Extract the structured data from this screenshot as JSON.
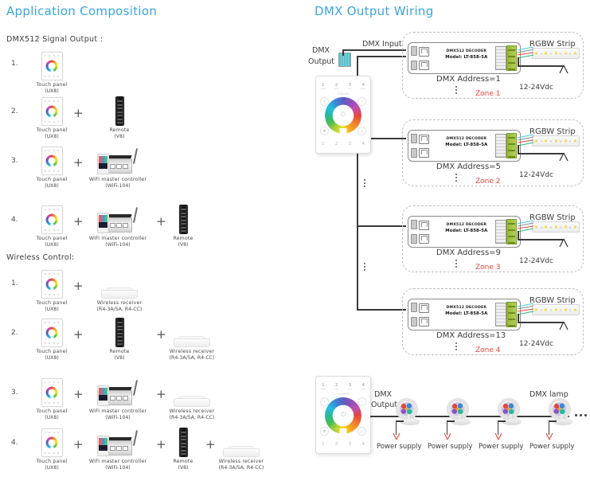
{
  "left": {
    "title": "Application Composition",
    "sections": [
      {
        "label": "DMX512 Signal Output :",
        "rows": [
          {
            "num": "1.",
            "items": [
              {
                "icon": "touch-panel",
                "cap": "Touch panel",
                "cap2": "(UX8)"
              }
            ]
          },
          {
            "num": "2.",
            "items": [
              {
                "icon": "touch-panel",
                "cap": "Touch panel",
                "cap2": "(UX8)"
              },
              {
                "icon": "remote",
                "cap": "Remote",
                "cap2": "(V8)"
              }
            ]
          },
          {
            "num": "3.",
            "items": [
              {
                "icon": "touch-panel",
                "cap": "Touch panel",
                "cap2": "(UX8)"
              },
              {
                "icon": "wifi-controller",
                "cap": "WiFi master controller",
                "cap2": "(WiFi-104)"
              }
            ]
          },
          {
            "num": "4.",
            "items": [
              {
                "icon": "touch-panel",
                "cap": "Touch panel",
                "cap2": "(UX8)"
              },
              {
                "icon": "wifi-controller",
                "cap": "WiFi master controller",
                "cap2": "(WiFi-104)"
              },
              {
                "icon": "remote",
                "cap": "Remote",
                "cap2": "(V8)"
              }
            ]
          }
        ]
      },
      {
        "label": "Wireless Control:",
        "rows": [
          {
            "num": "1.",
            "items": [
              {
                "icon": "touch-panel",
                "cap": "Touch panel",
                "cap2": "(UX8)"
              },
              {
                "icon": "wireless-receiver",
                "cap": "Wireless receiver",
                "cap2": "(R4-3A/5A, R4-CC)"
              }
            ]
          },
          {
            "num": "2.",
            "items": [
              {
                "icon": "touch-panel",
                "cap": "Touch panel",
                "cap2": "(UX8)"
              },
              {
                "icon": "remote",
                "cap": "Remote",
                "cap2": "(V8)"
              },
              {
                "icon": "wireless-receiver",
                "cap": "Wireless receiver",
                "cap2": "(R4-3A/5A, R4-CC)"
              }
            ]
          },
          {
            "num": "3.",
            "items": [
              {
                "icon": "touch-panel",
                "cap": "Touch panel",
                "cap2": "(UX8)"
              },
              {
                "icon": "wifi-controller",
                "cap": "WiFi master controller",
                "cap2": "(WiFi-104)"
              },
              {
                "icon": "wireless-receiver",
                "cap": "Wireless receiver",
                "cap2": "(R4-3A/5A, R4-CC)"
              }
            ]
          },
          {
            "num": "4.",
            "items": [
              {
                "icon": "touch-panel",
                "cap": "Touch panel",
                "cap2": "(UX8)"
              },
              {
                "icon": "wifi-controller",
                "cap": "WiFi master controller",
                "cap2": "(WiFi-104)"
              },
              {
                "icon": "remote",
                "cap": "Remote",
                "cap2": "(V8)"
              },
              {
                "icon": "wireless-receiver",
                "cap": "Wireless receiver",
                "cap2": "(R4-3A/5A, R4-CC)"
              }
            ]
          }
        ]
      }
    ],
    "plus_symbol": "+"
  },
  "right": {
    "title": "DMX Output Wiring",
    "dmx_output_label_line1": "DMX",
    "dmx_output_label_line2": "Output",
    "dmx_input_label": "DMX Input",
    "decoder": {
      "line1": "DMX512 DECODER",
      "line2": "Model: LT-858-5A"
    },
    "strip_label": "RGBW Strip",
    "voltage_label": "12-24Vdc",
    "zones": [
      {
        "address": "DMX Address=1",
        "name": "Zone 1"
      },
      {
        "address": "DMX Address=5",
        "name": "Zone 2"
      },
      {
        "address": "DMX Address=9",
        "name": "Zone 3"
      },
      {
        "address": "DMX Address=13",
        "name": "Zone 4"
      }
    ],
    "panel": {
      "numbers": [
        "1",
        "2",
        "3",
        "4"
      ],
      "bottom_numbers": [
        "1",
        "2",
        "3",
        "4"
      ],
      "color_label": "COLOR",
      "left_arrow": "‹",
      "right_arrow": "›",
      "power_icon": "⏻",
      "scene_icon": "✻",
      "auto_icon": "△"
    },
    "lamp_section": {
      "dmx_output_line1": "DMX",
      "dmx_output_line2": "Output",
      "dmx_lamp_label": "DMX lamp",
      "power_supply_label": "Power supply",
      "lamps_count": 4
    }
  },
  "colors": {
    "title_blue": "#3aa5dd",
    "zone_red": "#e8453c",
    "text_dark": "#3b3b3b",
    "wire": "#3a3a3a",
    "dashed_border": "#bdbdbd",
    "terminal_green": "#98b83a"
  }
}
